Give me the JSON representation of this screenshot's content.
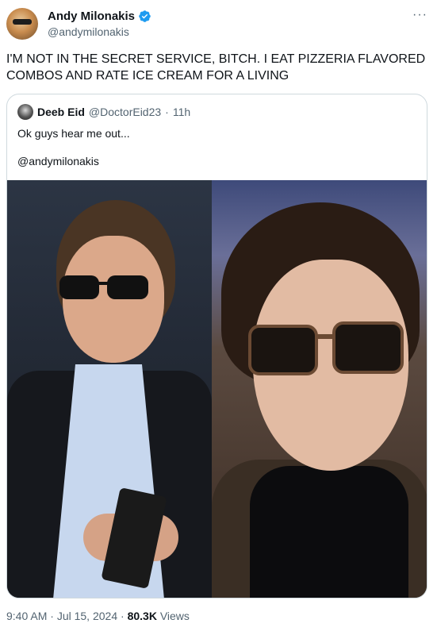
{
  "author": {
    "display_name": "Andy Milonakis",
    "handle": "@andymilonakis",
    "verified": true,
    "avatar_icon": "profile-avatar"
  },
  "more_menu": "···",
  "tweet_text": "I'M NOT IN THE SECRET SERVICE, BITCH. I EAT PIZZERIA FLAVORED COMBOS AND RATE ICE CREAM FOR A LIVING",
  "quoted": {
    "display_name": "Deeb Eid",
    "handle": "@DoctorEid23",
    "separator": "·",
    "time": "11h",
    "text": "Ok guys hear me out...",
    "mention": "@andymilonakis",
    "media": [
      "photo-secret-service-agent-sunglasses",
      "photo-person-sunglasses"
    ]
  },
  "footer": {
    "time": "9:40 AM",
    "separator": "·",
    "date": "Jul 15, 2024",
    "views_count": "80.3K",
    "views_label": "Views"
  },
  "colors": {
    "text_primary": "#0f1419",
    "text_secondary": "#536471",
    "border": "#cfd9de",
    "verified_blue": "#1d9bf0"
  }
}
